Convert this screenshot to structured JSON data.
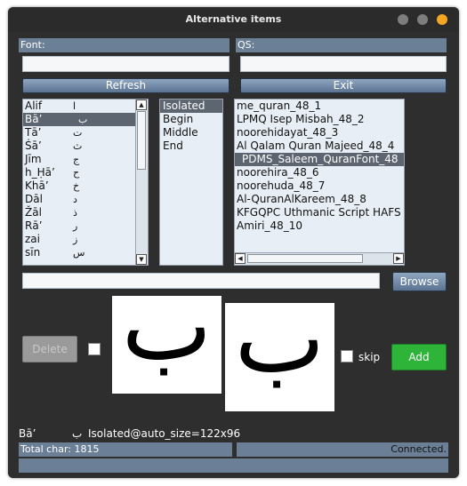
{
  "window": {
    "title": "Alternative items"
  },
  "labels": {
    "font": "Font:",
    "qs": "QS:"
  },
  "buttons": {
    "refresh": "Refresh",
    "exit": "Exit",
    "browse": "Browse",
    "delete": "Delete",
    "add": "Add"
  },
  "skip_label": "skip",
  "letters": [
    {
      "name": "Alif",
      "glyph": "ا"
    },
    {
      "name": "Bā’",
      "glyph": "ب"
    },
    {
      "name": "Tā’",
      "glyph": "ت"
    },
    {
      "name": "Ṡā’",
      "glyph": "ث"
    },
    {
      "name": "Jīm",
      "glyph": "ج"
    },
    {
      "name": "h_Ḥā’",
      "glyph": "ح"
    },
    {
      "name": "Khā’",
      "glyph": "خ"
    },
    {
      "name": "Dāl",
      "glyph": "د"
    },
    {
      "name": "Žāl",
      "glyph": "ذ"
    },
    {
      "name": "Rā’",
      "glyph": "ر"
    },
    {
      "name": "zai",
      "glyph": "ز"
    },
    {
      "name": "sīn",
      "glyph": "س"
    }
  ],
  "forms": [
    "Isolated",
    "Begin",
    "Middle",
    "End"
  ],
  "fonts": [
    "me_quran_48_1",
    "LPMQ Isep Misbah_48_2",
    "noorehidayat_48_3",
    "Al Qalam Quran Majeed_48_4",
    "PDMS_Saleem_QuranFont_48",
    "noorehira_48_6",
    "noorehuda_48_7",
    "Al-QuranAlKareem_48_8",
    "KFGQPC Uthmanic Script HAFS",
    "Amiri_48_10"
  ],
  "preview_glyph": "ب",
  "info": {
    "letter": "Bā’",
    "glyph": "ب",
    "detail": "Isolated@auto_size=122x96"
  },
  "status": {
    "total": "Total char: 1815",
    "connection": "Connected."
  },
  "colors": {
    "accent_green": "#2fb43a",
    "header_blue": "#6b7f96",
    "selection": "#5d6570"
  }
}
